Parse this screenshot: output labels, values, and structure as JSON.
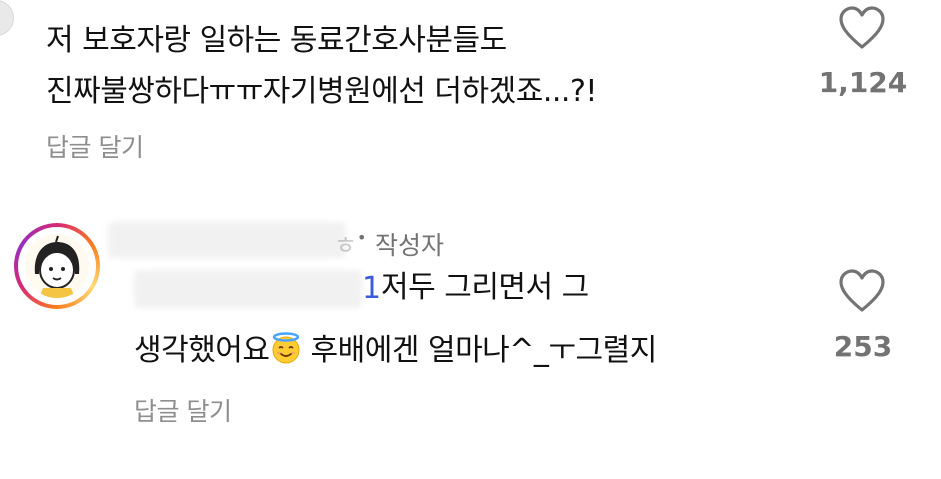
{
  "comments": [
    {
      "line1": "저 보호자랑 일하는 동료간호사분들도",
      "line2": "진짜불쌍하다ㅠㅠ자기병원에선 더하겠죠...?!",
      "reply_label": "답글 달기",
      "like_count": "1,124",
      "icon": "heart-outline-icon"
    },
    {
      "author_tail": "ㅎ",
      "separator": "•",
      "author_badge": "작성자",
      "mention_tail": "1",
      "line1": "저두 그리면서 그",
      "line2_a": "생각했어요",
      "emoji": "smiling-face-with-halo",
      "line2_b": " 후배에겐 얼마나^_ㅜ그렬지",
      "reply_label": "답글 달기",
      "like_count": "253",
      "icon": "heart-outline-icon"
    }
  ],
  "colors": {
    "text": "#111111",
    "muted": "#737373",
    "mention": "#3b5bdb"
  }
}
